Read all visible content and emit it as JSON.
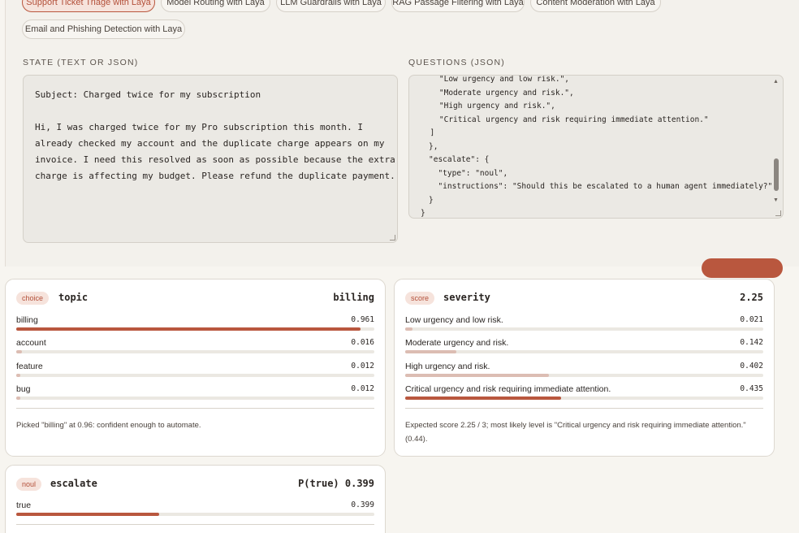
{
  "presets": [
    {
      "label": "Support Ticket Triage with Laya",
      "active": true
    },
    {
      "label": "Model Routing with Laya",
      "active": false
    },
    {
      "label": "LLM Guardrails with Laya",
      "active": false
    },
    {
      "label": "RAG Passage Filtering with Laya",
      "active": false
    },
    {
      "label": "Content Moderation with Laya",
      "active": false
    },
    {
      "label": "Email and Phishing Detection with Laya",
      "active": false
    }
  ],
  "state_label": "STATE (TEXT OR JSON)",
  "questions_label": "QUESTIONS (JSON)",
  "state_text": "Subject: Charged twice for my subscription\n\nHi, I was charged twice for my Pro subscription this month. I\nalready checked my account and the duplicate charge appears on my\ninvoice. I need this resolved as soon as possible because the extra\ncharge is affecting my budget. Please refund the duplicate payment.",
  "questions_lines": [
    "    \"Low urgency and low risk.\",",
    "    \"Moderate urgency and risk.\",",
    "    \"High urgency and risk.\",",
    "    \"Critical urgency and risk requiring immediate attention.\"",
    "  ]",
    "},",
    "\"escalate\": {",
    "  \"type\": \"noul\",",
    "  \"instructions\": \"Should this be escalated to a human agent immediately?\"",
    "}",
    "}"
  ],
  "cards": [
    {
      "badge": "choice",
      "name": "topic",
      "result": "billing",
      "rows": [
        {
          "label": "billing",
          "value": "0.961",
          "p": 0.961
        },
        {
          "label": "account",
          "value": "0.016",
          "p": 0.016
        },
        {
          "label": "feature",
          "value": "0.012",
          "p": 0.012
        },
        {
          "label": "bug",
          "value": "0.012",
          "p": 0.012
        }
      ],
      "note": "Picked \"billing\" at 0.96: confident enough to automate."
    },
    {
      "badge": "score",
      "name": "severity",
      "result": "2.25",
      "rows": [
        {
          "label": "Low urgency and low risk.",
          "value": "0.021",
          "p": 0.021
        },
        {
          "label": "Moderate urgency and risk.",
          "value": "0.142",
          "p": 0.142
        },
        {
          "label": "High urgency and risk.",
          "value": "0.402",
          "p": 0.402
        },
        {
          "label": "Critical urgency and risk requiring immediate attention.",
          "value": "0.435",
          "p": 0.435
        }
      ],
      "note": "Expected score 2.25 / 3; most likely level is \"Critical urgency and risk requiring immediate attention.\" (0.44)."
    },
    {
      "badge": "noul",
      "name": "escalate",
      "result": "P(true) 0.399",
      "rows": [
        {
          "label": "true",
          "value": "0.399",
          "p": 0.399
        }
      ],
      "note": ""
    }
  ],
  "colors": {
    "accent": "#b9573e",
    "muted_bar": "#dcbdb3",
    "track": "#ebe8e2"
  }
}
